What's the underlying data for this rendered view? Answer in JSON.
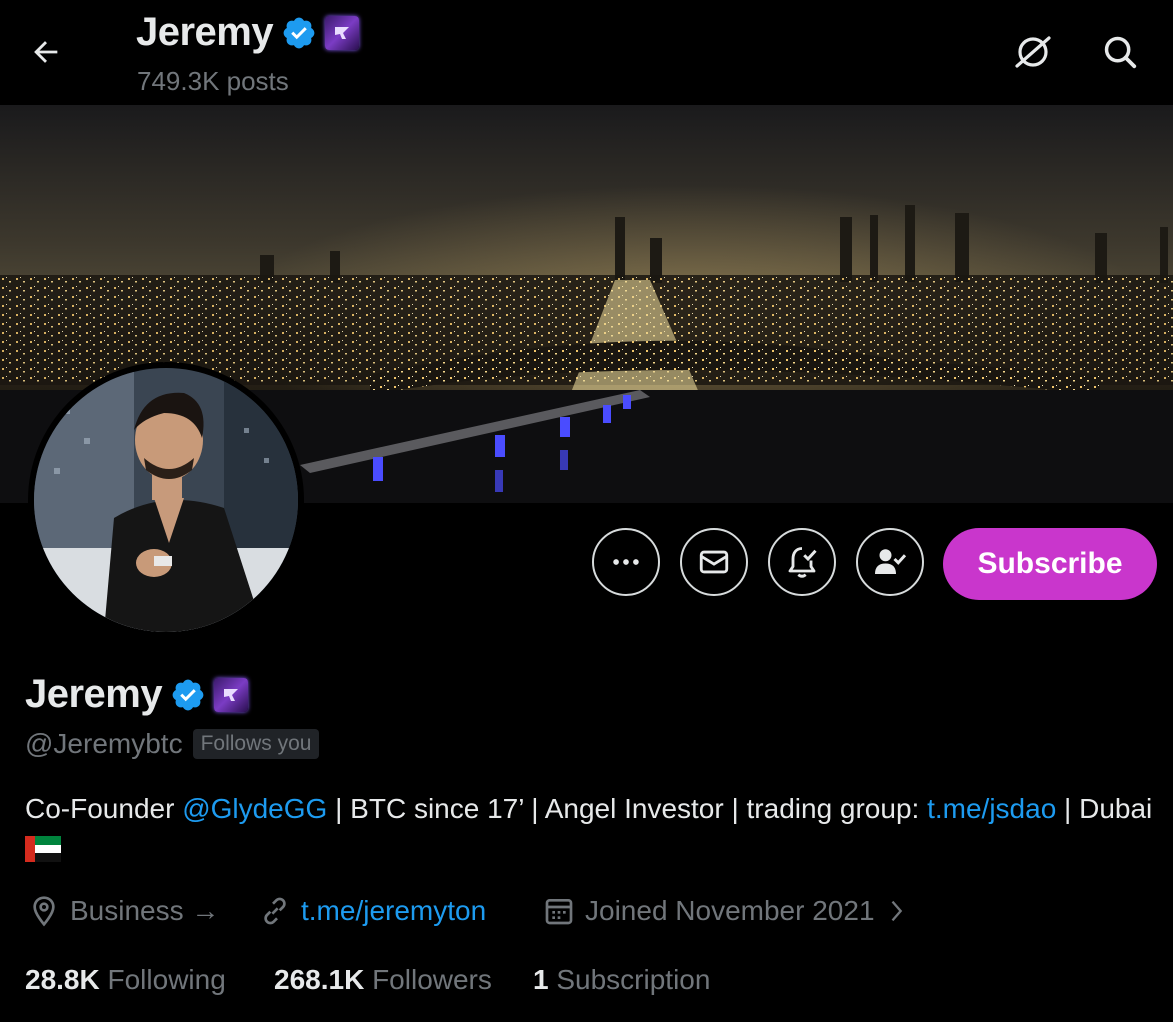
{
  "header": {
    "name": "Jeremy",
    "posts": "749.3K posts",
    "icons": [
      "back-arrow-icon",
      "grok-icon",
      "search-icon"
    ]
  },
  "profile": {
    "name": "Jeremy",
    "handle": "@Jeremybtc",
    "follows_you": "Follows you",
    "bio": {
      "p1": "Co-Founder ",
      "mention": "@GlydeGG",
      "p2": " | BTC since 17’ | Angel Investor | trading group: ",
      "link": "t.me/jsdao",
      "p3": " | Dubai "
    },
    "category": "Business →",
    "website": "t.me/jeremyton",
    "joined": "Joined November 2021"
  },
  "actions": {
    "subscribe_label": "Subscribe",
    "icons": [
      "more-icon",
      "message-icon",
      "notifications-icon",
      "following-icon"
    ]
  },
  "stats": {
    "following_count": "28.8K",
    "following_label": " Following",
    "followers_count": "268.1K",
    "followers_label": " Followers",
    "subscription_count": "1",
    "subscription_label": " Subscription"
  },
  "colors": {
    "accent": "#1d9bf0",
    "subscribe": "#c936cc",
    "muted": "#71767b",
    "background": "#000000"
  }
}
